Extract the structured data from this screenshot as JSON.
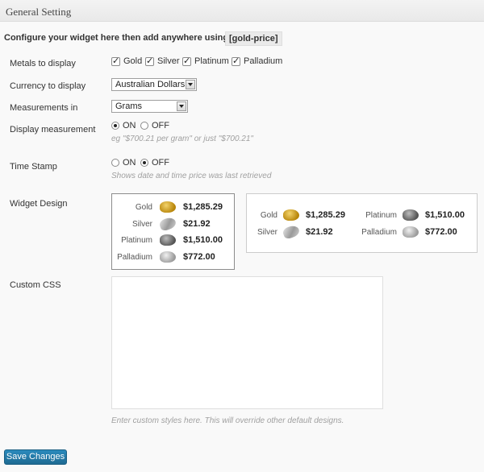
{
  "header": {
    "title": "General Setting"
  },
  "intro": {
    "text": "Configure your widget here then add anywhere using shortcode",
    "shortcode": "[gold-price]"
  },
  "metals": {
    "label": "Metals to display",
    "items": [
      {
        "label": "Gold",
        "checked": true
      },
      {
        "label": "Silver",
        "checked": true
      },
      {
        "label": "Platinum",
        "checked": true
      },
      {
        "label": "Palladium",
        "checked": true
      }
    ]
  },
  "currency": {
    "label": "Currency to display",
    "value": "Australian Dollars"
  },
  "measurement": {
    "label": "Measurements in",
    "value": "Grams"
  },
  "display_measurement": {
    "label": "Display measurement",
    "on_label": "ON",
    "off_label": "OFF",
    "selected": "ON",
    "hint": "eg \"$700.21 per gram\" or just \"$700.21\""
  },
  "timestamp": {
    "label": "Time Stamp",
    "on_label": "ON",
    "off_label": "OFF",
    "selected": "OFF",
    "hint": "Shows date and time price was last retrieved"
  },
  "widget_design": {
    "label": "Widget Design",
    "prices": [
      {
        "name": "Gold",
        "price": "$1,285.29",
        "icon": "gold-nugget-icon"
      },
      {
        "name": "Silver",
        "price": "$21.92",
        "icon": "silver-bar-icon"
      },
      {
        "name": "Platinum",
        "price": "$1,510.00",
        "icon": "platinum-nugget-icon"
      },
      {
        "name": "Palladium",
        "price": "$772.00",
        "icon": "palladium-nugget-icon"
      }
    ]
  },
  "custom_css": {
    "label": "Custom CSS",
    "value": "",
    "hint": "Enter custom styles here. This will override other default designs."
  },
  "save_button": {
    "label": "Save Changes"
  },
  "colors": {
    "primary_button": "#2180b4",
    "hint_text": "#a0a0a0"
  }
}
